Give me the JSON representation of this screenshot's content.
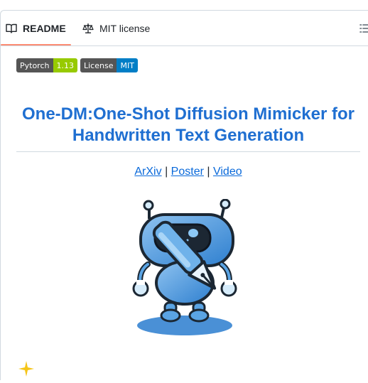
{
  "tabs": {
    "readme_label": "README",
    "license_label": "MIT license"
  },
  "badges": [
    {
      "label": "Pytorch",
      "value": "1.13",
      "color": "#97ca00"
    },
    {
      "label": "License",
      "value": "MIT",
      "color": "#007ec6"
    }
  ],
  "content": {
    "title": "One-DM:One-Shot Diffusion Mimicker for Handwritten Text Generation",
    "links": [
      {
        "label": "ArXiv"
      },
      {
        "label": "Poster"
      },
      {
        "label": "Video"
      }
    ],
    "separator": "|",
    "logo_icon": "robot-with-pen-icon",
    "next_section_icon": "sparkle-icon"
  },
  "colors": {
    "title": "#1f6fd1",
    "link": "#0969da",
    "active_tab_underline": "#fd8c73"
  }
}
